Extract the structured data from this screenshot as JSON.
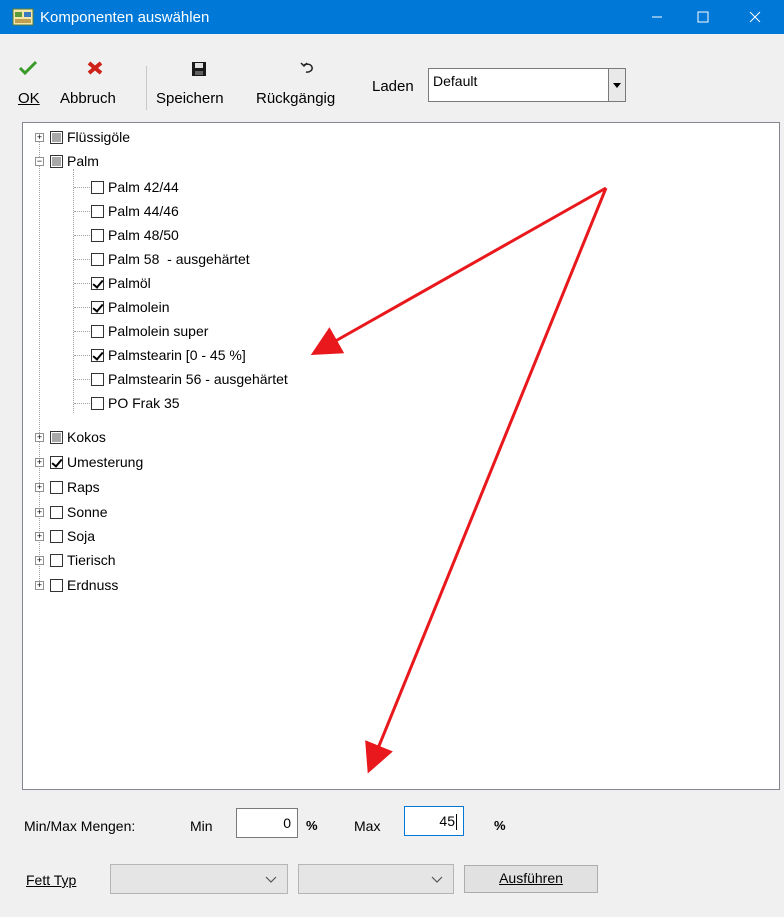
{
  "window": {
    "title": "Komponenten auswählen"
  },
  "toolbar": {
    "ok": "OK",
    "cancel": "Abbruch",
    "save": "Speichern",
    "undo": "Rückgängig",
    "load_label": "Laden",
    "load_value": "Default"
  },
  "tree": {
    "groups": [
      {
        "label": "Flüssigöle",
        "state": "partial"
      },
      {
        "label": "Palm",
        "state": "partial",
        "children": [
          {
            "label": "Palm 42/44",
            "checked": false
          },
          {
            "label": "Palm 44/46",
            "checked": false
          },
          {
            "label": "Palm 48/50",
            "checked": false
          },
          {
            "label": "Palm 58  - ausgehärtet",
            "checked": false
          },
          {
            "label": "Palmöl",
            "checked": true
          },
          {
            "label": "Palmolein",
            "checked": true
          },
          {
            "label": "Palmolein super",
            "checked": false
          },
          {
            "label": "Palmstearin [0 - 45 %]",
            "checked": true
          },
          {
            "label": "Palmstearin 56 - ausgehärtet",
            "checked": false
          },
          {
            "label": "PO Frak 35",
            "checked": false
          }
        ]
      },
      {
        "label": "Kokos",
        "state": "partial"
      },
      {
        "label": "Umesterung",
        "state": "checked"
      },
      {
        "label": "Raps",
        "state": "unchecked"
      },
      {
        "label": "Sonne",
        "state": "unchecked"
      },
      {
        "label": "Soja",
        "state": "unchecked"
      },
      {
        "label": "Tierisch",
        "state": "unchecked"
      },
      {
        "label": "Erdnuss",
        "state": "unchecked"
      }
    ]
  },
  "minmax": {
    "label": "Min/Max Mengen:",
    "min_label": "Min",
    "min_value": "0",
    "min_unit": "%",
    "max_label": "Max",
    "max_value": "45",
    "max_unit": "%"
  },
  "fett": {
    "label": "Fett Typ",
    "select1": "",
    "select2": "",
    "run": "Ausführen"
  },
  "colors": {
    "titlebar": "#0078d7",
    "arrow": "#e8181c"
  }
}
